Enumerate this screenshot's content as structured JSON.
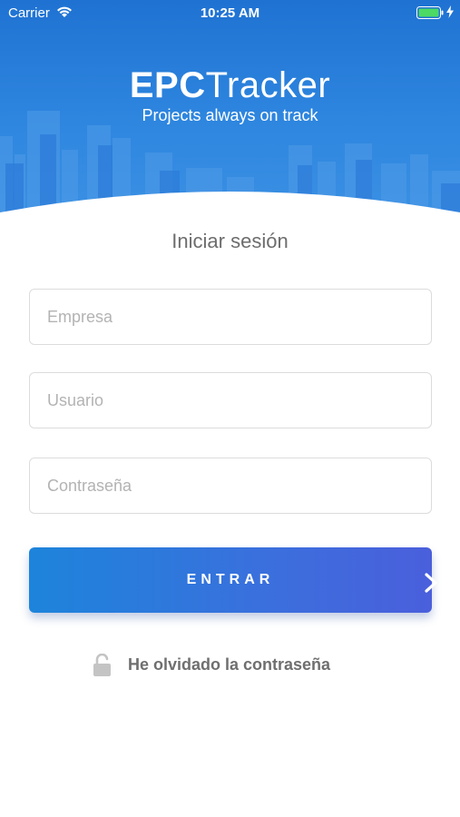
{
  "status_bar": {
    "carrier": "Carrier",
    "time": "10:25 AM",
    "wifi_icon": "wifi-icon",
    "battery_icon": "battery-icon",
    "battery_color": "#4cd964"
  },
  "logo": {
    "name_bold": "EPC",
    "name_light": "Tracker",
    "tagline": "Projects always on track"
  },
  "login": {
    "title": "Iniciar sesión",
    "company_placeholder": "Empresa",
    "user_placeholder": "Usuario",
    "password_placeholder": "Contraseña",
    "submit_label": "ENTRAR",
    "submit_icon": "chevron-right-icon",
    "forgot_label": "He olvidado la contraseña",
    "forgot_icon": "unlock-icon"
  },
  "colors": {
    "brand_blue": "#1f72d2",
    "button_start": "#1d84db",
    "button_end": "#4a5fdc",
    "text_muted": "#6d6d6d"
  }
}
